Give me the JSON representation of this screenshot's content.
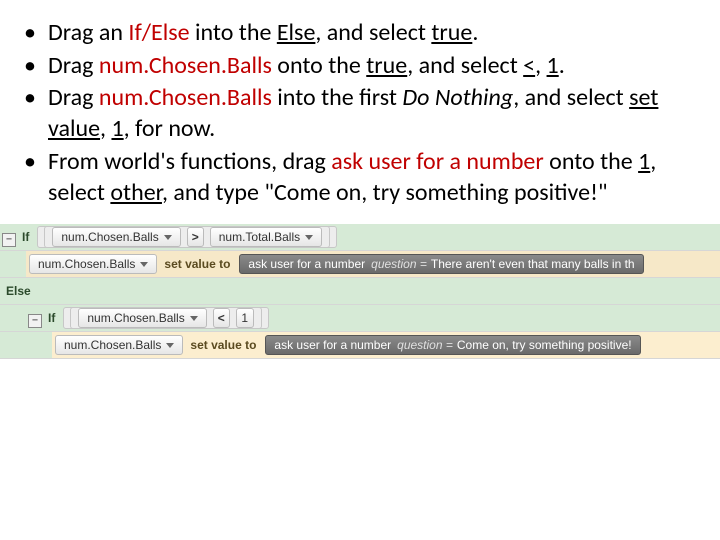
{
  "bullets": [
    {
      "p1": "Drag an ",
      "r1": "If/Else",
      "p2": " into the ",
      "u1": "Else",
      "p3": ", and select ",
      "u2": "true",
      "p4": "."
    },
    {
      "p1": "Drag ",
      "r1": "num.Chosen.Balls",
      "p2": " onto the ",
      "u1": "true",
      "p3": ", and select ",
      "u2": "<",
      "p4": ", ",
      "u3": "1",
      "p5": "."
    },
    {
      "p1": "Drag ",
      "r1": "num.Chosen.Balls",
      "p2": " into the first ",
      "e1": "Do Nothing",
      "p3": ", and select ",
      "u1": "set value",
      "p4": ", ",
      "u2": "1",
      "p5": ", for now."
    },
    {
      "p1": "From world's functions, drag ",
      "r1": "ask user for a number",
      "p2": " onto the ",
      "u1": "1",
      "p3": ", select ",
      "u2": "other",
      "p4": ", and type \"Come on, try something positive!\""
    }
  ],
  "code": {
    "toggle": "−",
    "if": "If",
    "else": "Else",
    "var": "num.Chosen.Balls",
    "var2": "num.Total.Balls",
    "gt": ">",
    "lt": "<",
    "one": "1",
    "set": "set value to",
    "func": "ask user for a number",
    "qlabel": "question =",
    "q1": "There aren't even that many balls in th",
    "q2": "Come on, try something positive!"
  }
}
